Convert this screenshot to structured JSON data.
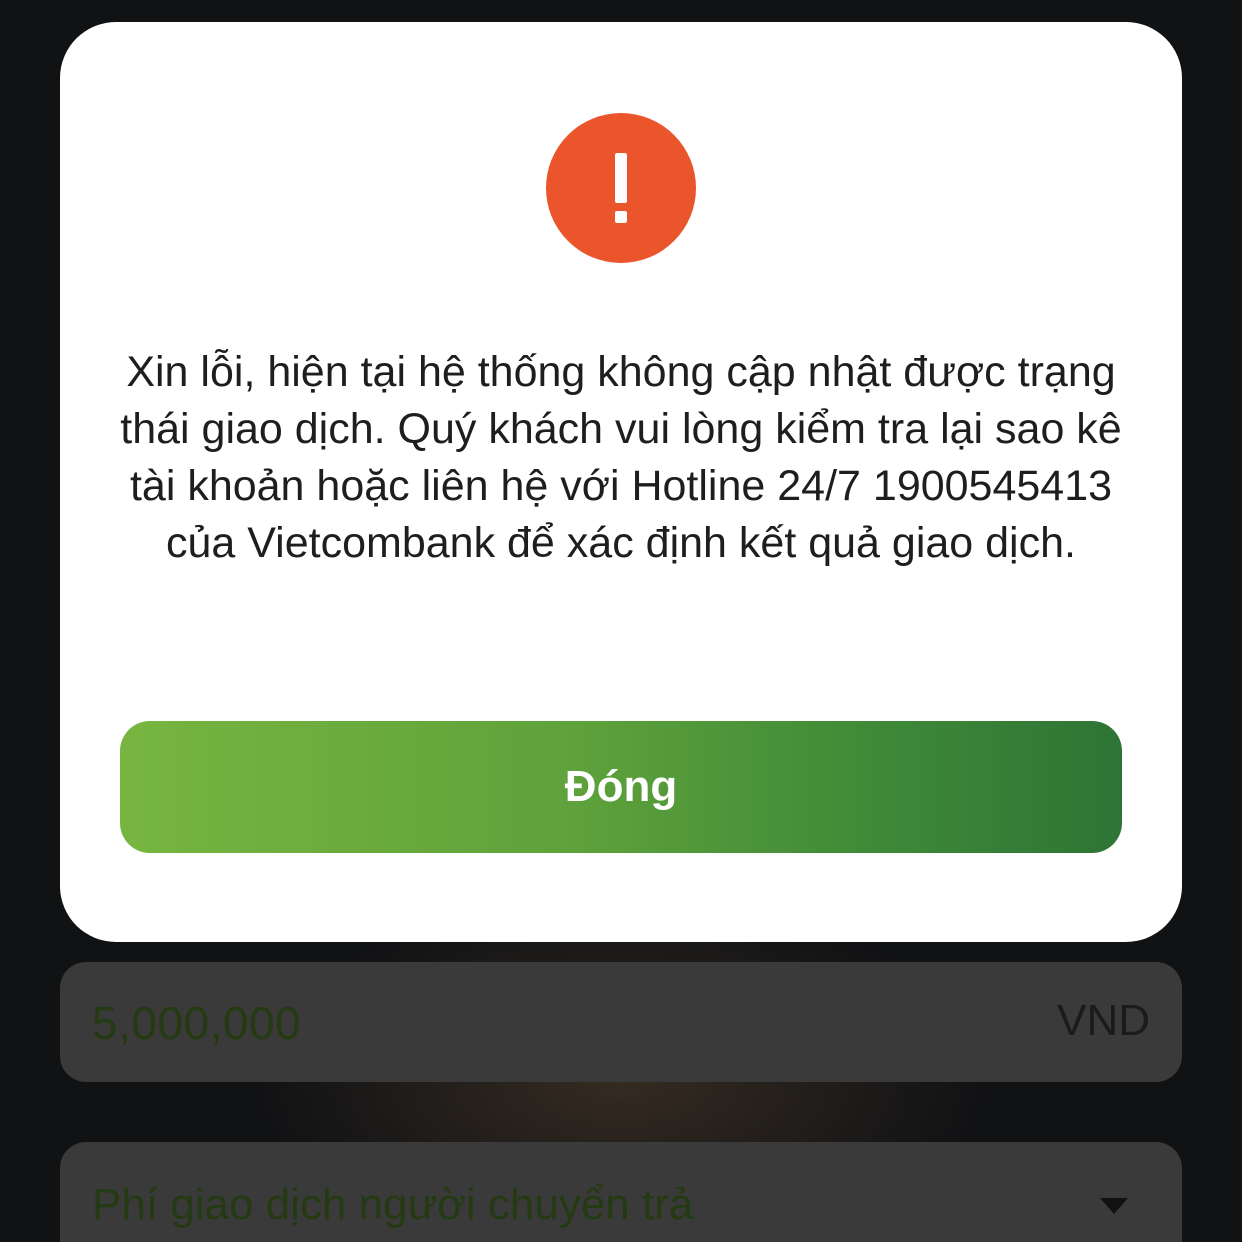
{
  "background": {
    "amount_field": {
      "value": "5,000,000",
      "currency": "VND"
    },
    "fee_field": {
      "label": "Phí giao dịch người chuyển trả",
      "icon": "chevron-down-icon"
    }
  },
  "dialog": {
    "icon": "exclamation-icon",
    "icon_color": "#EA552B",
    "message": "Xin lỗi, hiện tại hệ thống không cập nhật được trạng thái giao dịch. Quý khách vui lòng kiểm tra lại sao kê tài khoản hoặc liên hệ với Hotline 24/7 1900545413 của Vietcombank để xác định kết quả giao dịch.",
    "close_label": "Đóng",
    "button_gradient": [
      "#78B540",
      "#2E7436"
    ]
  }
}
